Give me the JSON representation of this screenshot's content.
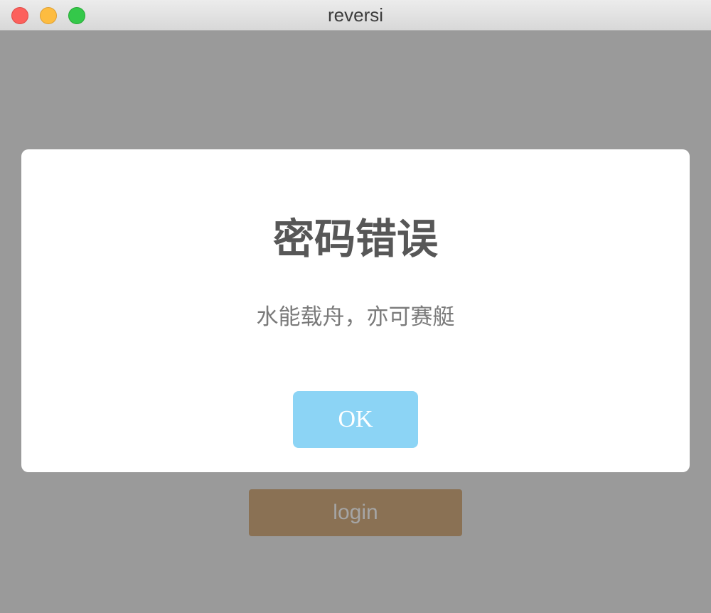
{
  "window": {
    "title": "reversi"
  },
  "main": {
    "login_label": "login"
  },
  "dialog": {
    "title": "密码错误",
    "message": "水能载舟，亦可赛艇",
    "ok_label": "OK"
  },
  "colors": {
    "backdrop": "#9a9a9a",
    "login_button": "#8a7154",
    "ok_button": "#8cd4f5",
    "dialog_background": "#ffffff"
  },
  "icons": {
    "close": "close-traffic-light-icon",
    "minimize": "minimize-traffic-light-icon",
    "maximize": "maximize-traffic-light-icon"
  }
}
